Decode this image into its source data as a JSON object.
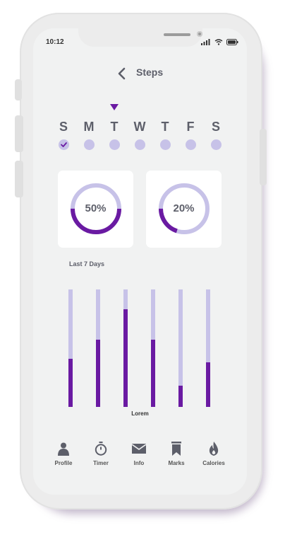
{
  "status": {
    "time": "10:12"
  },
  "header": {
    "title": "Steps"
  },
  "week": {
    "days": [
      "S",
      "M",
      "T",
      "W",
      "T",
      "F",
      "S"
    ],
    "selected_index": 2,
    "checked_index": 0
  },
  "rings": [
    {
      "label": "50%",
      "value": 0.5
    },
    {
      "label": "20%",
      "value": 0.2
    }
  ],
  "section": {
    "label": "Last 7 Days"
  },
  "chart_data": {
    "type": "bar",
    "categories": [
      "",
      "",
      "",
      "",
      "",
      ""
    ],
    "values": [
      0.41,
      0.57,
      0.83,
      0.57,
      0.18,
      0.38
    ],
    "xlabel": "Lorem",
    "ylim": [
      0,
      1
    ]
  },
  "nav": {
    "items": [
      {
        "label": "Profile",
        "icon": "person-icon"
      },
      {
        "label": "Timer",
        "icon": "stopwatch-icon"
      },
      {
        "label": "Info",
        "icon": "envelope-icon"
      },
      {
        "label": "Marks",
        "icon": "bookmark-icon"
      },
      {
        "label": "Calories",
        "icon": "flame-icon"
      }
    ]
  },
  "colors": {
    "accent": "#6a1aa2",
    "track": "#c7c2e8",
    "text": "#5d5f6a",
    "screen_bg": "#f1f2f2"
  }
}
